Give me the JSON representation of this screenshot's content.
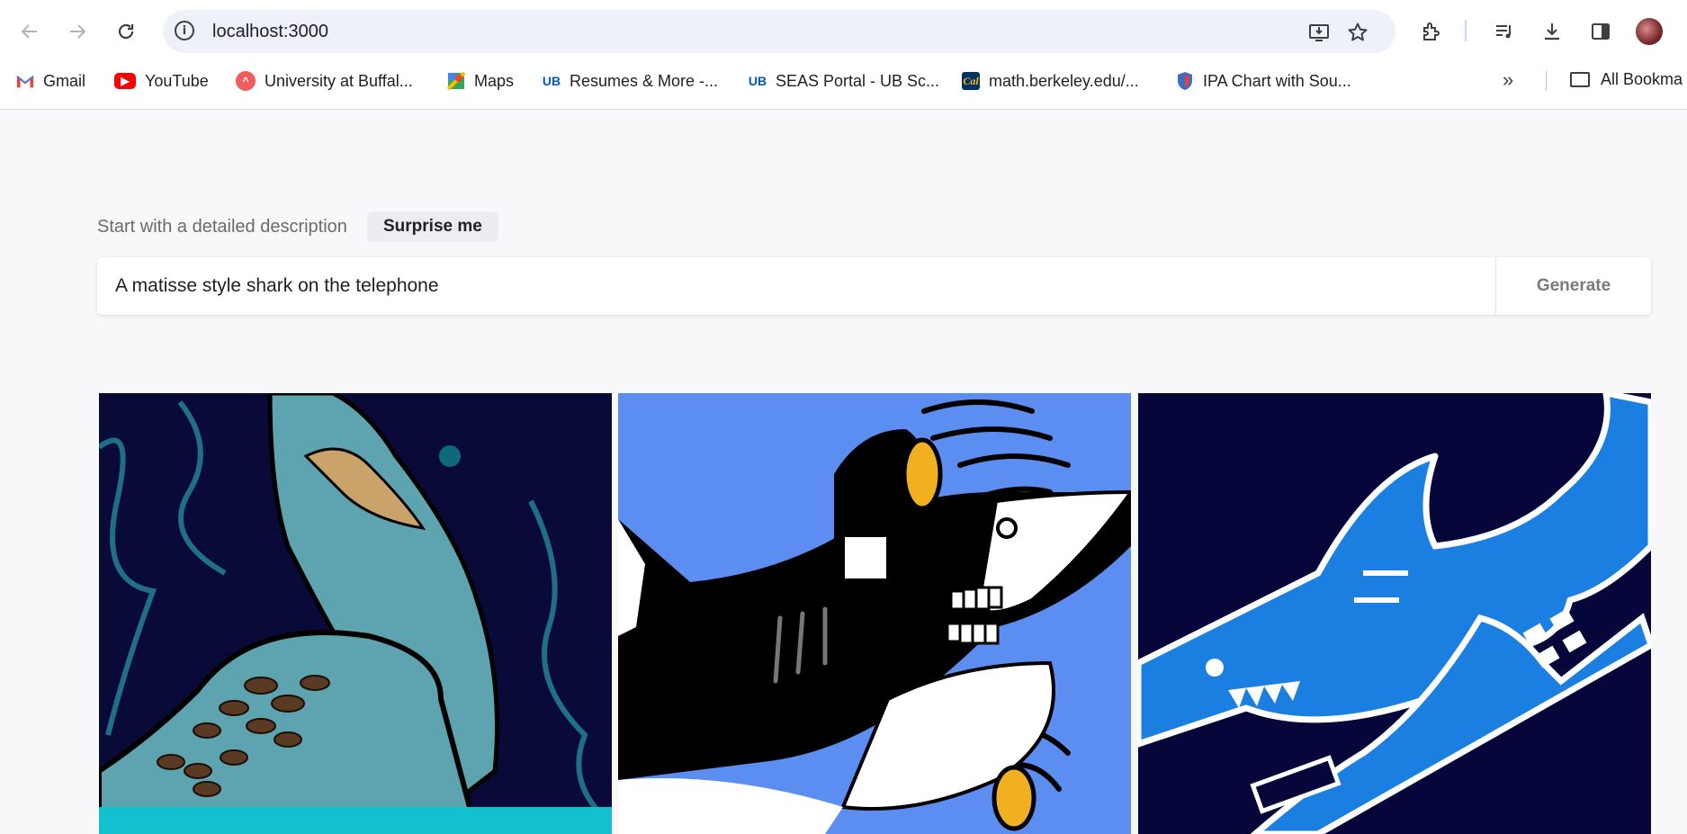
{
  "browser": {
    "url": "localhost:3000",
    "bookmarks": [
      {
        "label": "Gmail",
        "icon": "gmail-icon"
      },
      {
        "label": "YouTube",
        "icon": "youtube-icon"
      },
      {
        "label": "University at Buffal...",
        "icon": "ub-icon"
      },
      {
        "label": "Maps",
        "icon": "maps-icon"
      },
      {
        "label": "Resumes & More -...",
        "icon": "ub-logo-icon"
      },
      {
        "label": "SEAS Portal - UB Sc...",
        "icon": "ub-logo-icon"
      },
      {
        "label": "math.berkeley.edu/...",
        "icon": "cal-icon"
      },
      {
        "label": "IPA Chart with Sou...",
        "icon": "shield-icon"
      }
    ],
    "all_bookmarks_label": "All Bookma"
  },
  "page": {
    "prompt_label": "Start with a detailed description",
    "surprise_label": "Surprise me",
    "prompt_value": "A matisse style shark on the telephone",
    "generate_label": "Generate",
    "images": [
      {
        "alt": "generated-image-1",
        "colors": [
          "#0a0a3a",
          "#5aa0b0"
        ]
      },
      {
        "alt": "generated-image-2",
        "colors": [
          "#5b8ef0",
          "#000000"
        ]
      },
      {
        "alt": "generated-image-3",
        "colors": [
          "#06063a",
          "#1a7fe0"
        ]
      }
    ]
  }
}
